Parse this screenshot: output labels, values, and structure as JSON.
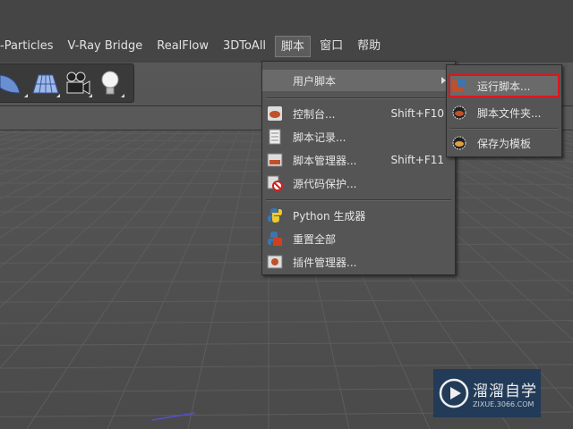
{
  "menubar": {
    "items": [
      "-Particles",
      "V-Ray Bridge",
      "RealFlow",
      "3DToAll",
      "脚本",
      "窗口",
      "帮助"
    ]
  },
  "toolbar": {
    "icons": [
      "sphere-icon",
      "grid-plane-icon",
      "camera-icon",
      "light-bulb-icon"
    ]
  },
  "main_menu": {
    "items": [
      {
        "label": "用户脚本",
        "shortcut": "",
        "icon": "none",
        "submenu": true
      },
      {
        "label": "控制台...",
        "shortcut": "Shift+F10",
        "icon": "console-icon"
      },
      {
        "label": "脚本记录...",
        "shortcut": "",
        "icon": "script-log-icon"
      },
      {
        "label": "脚本管理器...",
        "shortcut": "Shift+F11",
        "icon": "script-manager-icon"
      },
      {
        "label": "源代码保护...",
        "shortcut": "",
        "icon": "source-protect-icon"
      },
      {
        "label": "Python 生成器",
        "shortcut": "",
        "icon": "python-icon"
      },
      {
        "label": "重置全部",
        "shortcut": "",
        "icon": "reset-icon"
      },
      {
        "label": "插件管理器...",
        "shortcut": "",
        "icon": "plugin-manager-icon"
      }
    ]
  },
  "sub_menu": {
    "items": [
      {
        "label": "运行脚本...",
        "icon": "run-script-icon"
      },
      {
        "label": "脚本文件夹...",
        "icon": "script-folder-icon"
      },
      {
        "label": "保存为模板",
        "icon": "save-template-icon"
      }
    ]
  },
  "watermark": {
    "title": "溜溜自学",
    "subtitle": "ZIXUE.3066.COM"
  },
  "colors": {
    "highlight_border": "#e0141e",
    "menu_bg": "#555555",
    "watermark_bg": "#1f3a5a"
  }
}
